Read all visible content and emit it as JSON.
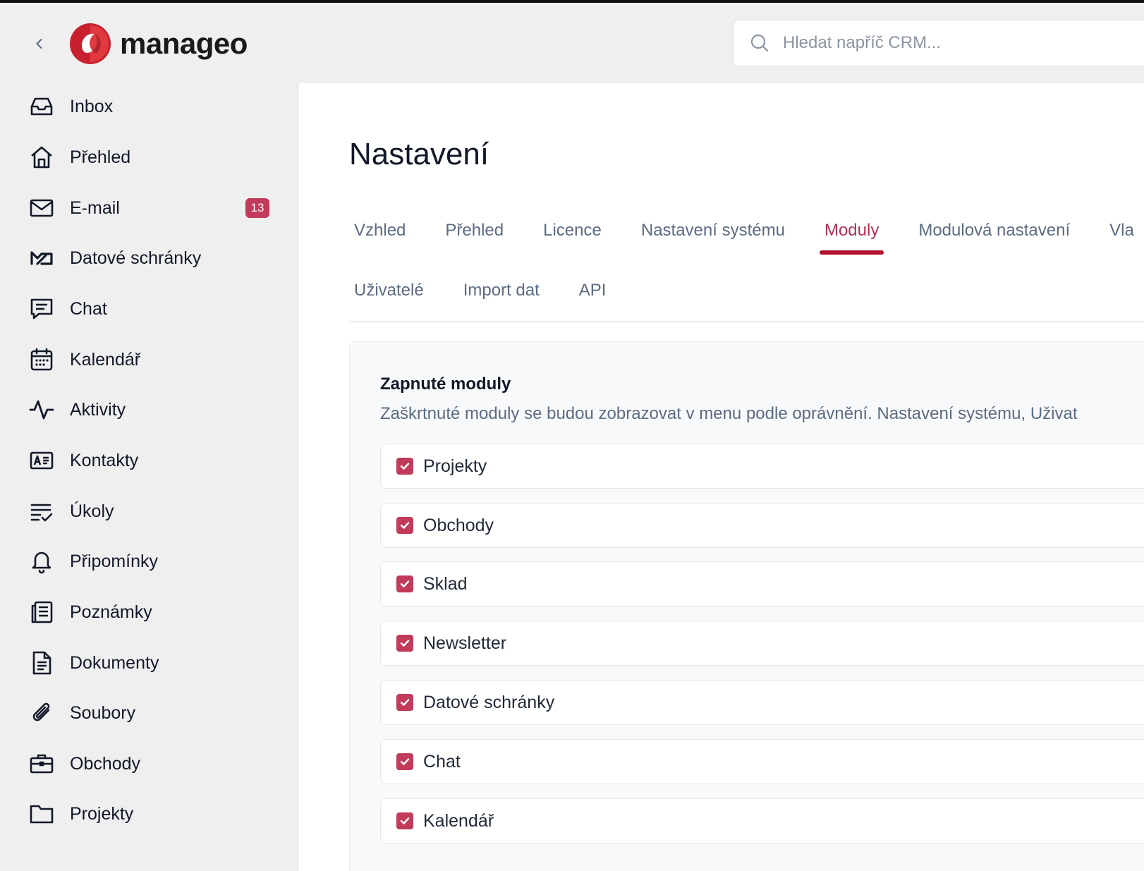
{
  "header": {
    "brand": "manageo",
    "search_placeholder": "Hledat napříč CRM..."
  },
  "sidebar": {
    "items": [
      {
        "label": "Inbox",
        "icon": "inbox-icon"
      },
      {
        "label": "Přehled",
        "icon": "home-icon"
      },
      {
        "label": "E-mail",
        "icon": "mail-icon",
        "badge": "13"
      },
      {
        "label": "Datové schránky",
        "icon": "databox-icon"
      },
      {
        "label": "Chat",
        "icon": "chat-icon"
      },
      {
        "label": "Kalendář",
        "icon": "calendar-icon"
      },
      {
        "label": "Aktivity",
        "icon": "activity-icon"
      },
      {
        "label": "Kontakty",
        "icon": "contact-card-icon"
      },
      {
        "label": "Úkoly",
        "icon": "task-list-icon"
      },
      {
        "label": "Připomínky",
        "icon": "bell-icon"
      },
      {
        "label": "Poznámky",
        "icon": "notes-icon"
      },
      {
        "label": "Dokumenty",
        "icon": "document-icon"
      },
      {
        "label": "Soubory",
        "icon": "paperclip-icon"
      },
      {
        "label": "Obchody",
        "icon": "briefcase-icon"
      },
      {
        "label": "Projekty",
        "icon": "folder-icon"
      }
    ]
  },
  "main": {
    "title": "Nastavení",
    "tabs_row1": [
      "Vzhled",
      "Přehled",
      "Licence",
      "Nastavení systému",
      "Moduly",
      "Modulová nastavení",
      "Vla"
    ],
    "tabs_row2": [
      "Uživatelé",
      "Import dat",
      "API"
    ],
    "active_tab": "Moduly",
    "panel": {
      "title": "Zapnuté moduly",
      "description": "Zaškrtnuté moduly se budou zobrazovat v menu podle oprávnění. Nastavení systému, Uživat",
      "modules": [
        {
          "label": "Projekty",
          "checked": true
        },
        {
          "label": "Obchody",
          "checked": true
        },
        {
          "label": "Sklad",
          "checked": true
        },
        {
          "label": "Newsletter",
          "checked": true
        },
        {
          "label": "Datové schránky",
          "checked": true
        },
        {
          "label": "Chat",
          "checked": true
        },
        {
          "label": "Kalendář",
          "checked": true
        }
      ]
    }
  },
  "colors": {
    "accent": "#c23b5a",
    "active_tab_underline": "#b0112f",
    "muted_text": "#5b6b82"
  }
}
